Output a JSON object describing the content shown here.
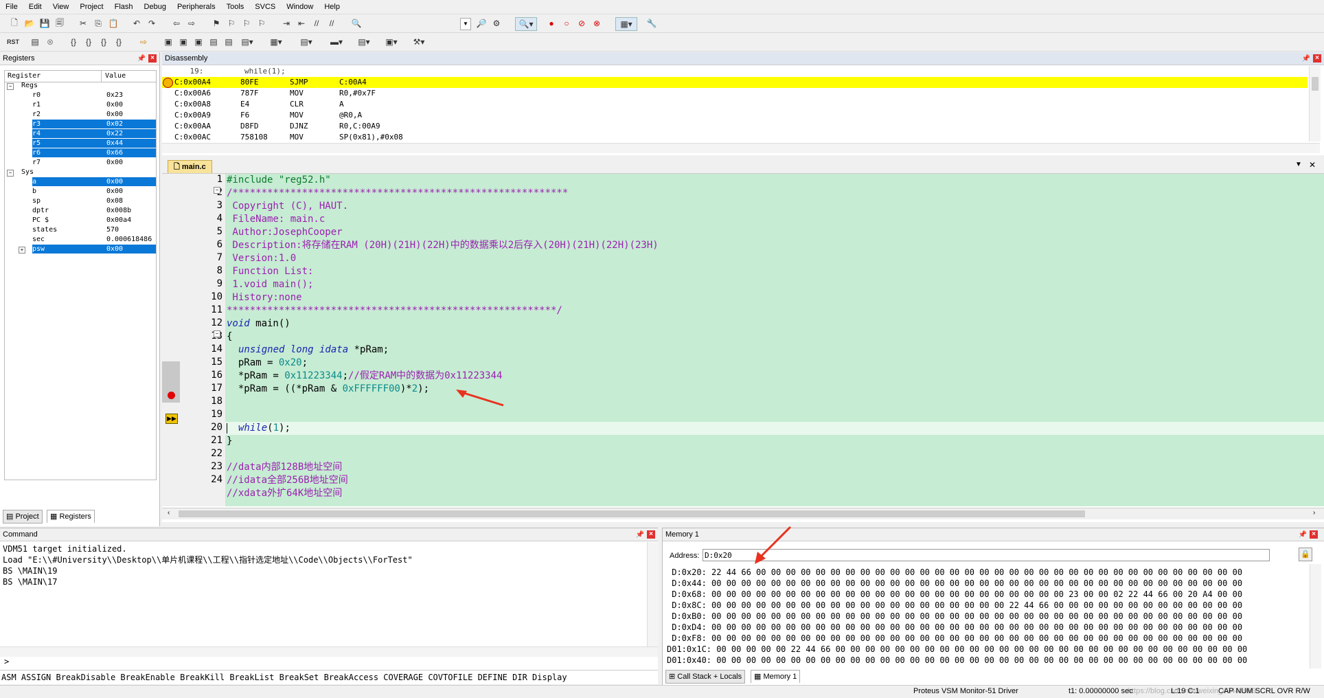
{
  "menu": [
    "File",
    "Edit",
    "View",
    "Project",
    "Flash",
    "Debug",
    "Peripherals",
    "Tools",
    "SVCS",
    "Window",
    "Help"
  ],
  "registers_pane": {
    "title": "Registers",
    "col_register": "Register",
    "col_value": "Value",
    "group_regs": "Regs",
    "group_sys": "Sys",
    "regs": [
      {
        "name": "r0",
        "value": "0x23",
        "selected": false
      },
      {
        "name": "r1",
        "value": "0x00",
        "selected": false
      },
      {
        "name": "r2",
        "value": "0x00",
        "selected": false
      },
      {
        "name": "r3",
        "value": "0x02",
        "selected": true
      },
      {
        "name": "r4",
        "value": "0x22",
        "selected": true
      },
      {
        "name": "r5",
        "value": "0x44",
        "selected": true
      },
      {
        "name": "r6",
        "value": "0x66",
        "selected": true
      },
      {
        "name": "r7",
        "value": "0x00",
        "selected": false
      }
    ],
    "sys": [
      {
        "name": "a",
        "value": "0x00",
        "selected": true
      },
      {
        "name": "b",
        "value": "0x00",
        "selected": false
      },
      {
        "name": "sp",
        "value": "0x08",
        "selected": false
      },
      {
        "name": "dptr",
        "value": "0x008b",
        "selected": false
      },
      {
        "name": "PC  $",
        "value": "0x00a4",
        "selected": false
      },
      {
        "name": "states",
        "value": "570",
        "selected": false
      },
      {
        "name": "sec",
        "value": "0.000618486",
        "selected": false
      },
      {
        "name": "psw",
        "value": "0x00",
        "selected": true
      }
    ],
    "tab_project": "Project",
    "tab_registers": "Registers"
  },
  "disassembly": {
    "title": "Disassembly",
    "source_line": "    19:         while(1);",
    "lines": [
      {
        "addr": "C:0x00A4",
        "bytes": "80FE",
        "mn": "SJMP",
        "op": "C:00A4",
        "current": true
      },
      {
        "addr": "C:0x00A6",
        "bytes": "787F",
        "mn": "MOV",
        "op": "R0,#0x7F",
        "current": false
      },
      {
        "addr": "C:0x00A8",
        "bytes": "E4",
        "mn": "CLR",
        "op": "A",
        "current": false
      },
      {
        "addr": "C:0x00A9",
        "bytes": "F6",
        "mn": "MOV",
        "op": "@R0,A",
        "current": false
      },
      {
        "addr": "C:0x00AA",
        "bytes": "D8FD",
        "mn": "DJNZ",
        "op": "R0,C:00A9",
        "current": false
      },
      {
        "addr": "C:0x00AC",
        "bytes": "758108",
        "mn": "MOV",
        "op": "SP(0x81),#0x08",
        "current": false
      }
    ]
  },
  "editor": {
    "tab": "main.c",
    "line_numbers": [
      "1",
      "2",
      "3",
      "4",
      "5",
      "6",
      "7",
      "8",
      "9",
      "10",
      "11",
      "12",
      "13",
      "14",
      "15",
      "16",
      "17",
      "18",
      "19",
      "20",
      "21",
      "22",
      "23",
      "24"
    ],
    "l1_pp": "#include ",
    "l1_str": "\"reg52.h\"",
    "l2": "/**********************************************************",
    "l3": " Copyright (C), HAUT.",
    "l4": " FileName: main.c",
    "l5": " Author:JosephCooper",
    "l6": " Description:将存储在RAM (20H)(21H)(22H)中的数据乘以2后存入(20H)(21H)(22H)(23H)",
    "l7": " Version:1.0",
    "l8": " Function List:",
    "l9": " 1.void main();",
    "l10": " History:none",
    "l11": "*********************************************************/",
    "l12_kw": "void",
    "l12_rest": " main()",
    "l13": "{",
    "l14_kw": "unsigned long idata",
    "l14_rest": " *pRam;",
    "l15_a": "  pRam = ",
    "l15_num": "0x20",
    "l15_b": ";",
    "l16_a": "  *pRam = ",
    "l16_num": "0x11223344",
    "l16_b": ";",
    "l16_cm": "//假定RAM中的数据为0x11223344",
    "l17_a": "  *pRam = ((*pRam & ",
    "l17_num": "0xFFFFFF00",
    "l17_b": ")*",
    "l17_num2": "2",
    "l17_c": ");",
    "l19_kw": "while",
    "l19_a": "(",
    "l19_num": "1",
    "l19_b": ");",
    "l20": "}",
    "l22": "//data内部128B地址空间",
    "l23": "//idata全部256B地址空间",
    "l24": "//xdata外扩64K地址空间"
  },
  "command": {
    "title": "Command",
    "lines": [
      "VDM51 target initialized.",
      "Load \"E:\\\\#University\\\\Desktop\\\\单片机课程\\\\工程\\\\指针选定地址\\\\Code\\\\Objects\\\\ForTest\"",
      "BS \\MAIN\\19",
      "BS \\MAIN\\17"
    ],
    "prompt": ">",
    "hint": "ASM ASSIGN BreakDisable BreakEnable BreakKill BreakList BreakSet BreakAccess COVERAGE COVTOFILE DEFINE DIR Display"
  },
  "memory": {
    "title": "Memory 1",
    "address_label": "Address:",
    "address_value": "D:0x20",
    "rows": [
      " D:0x20: 22 44 66 00 00 00 00 00 00 00 00 00 00 00 00 00 00 00 00 00 00 00 00 00 00 00 00 00 00 00 00 00 00 00 00 00",
      " D:0x44: 00 00 00 00 00 00 00 00 00 00 00 00 00 00 00 00 00 00 00 00 00 00 00 00 00 00 00 00 00 00 00 00 00 00 00 00",
      " D:0x68: 00 00 00 00 00 00 00 00 00 00 00 00 00 00 00 00 00 00 00 00 00 00 00 00 23 00 00 02 22 44 66 00 20 A4 00 00",
      " D:0x8C: 00 00 00 00 00 00 00 00 00 00 00 00 00 00 00 00 00 00 00 00 22 44 66 00 00 00 00 00 00 00 00 00 00 00 00 00",
      " D:0xB0: 00 00 00 00 00 00 00 00 00 00 00 00 00 00 00 00 00 00 00 00 00 00 00 00 00 00 00 00 00 00 00 00 00 00 00 00",
      " D:0xD4: 00 00 00 00 00 00 00 00 00 00 00 00 00 00 00 00 00 00 00 00 00 00 00 00 00 00 00 00 00 00 00 00 00 00 00 00",
      " D:0xF8: 00 00 00 00 00 00 00 00 00 00 00 00 00 00 00 00 00 00 00 00 00 00 00 00 00 00 00 00 00 00 00 00 00 00 00 00",
      "D01:0x1C: 00 00 00 00 00 22 44 66 00 00 00 00 00 00 00 00 00 00 00 00 00 00 00 00 00 00 00 00 00 00 00 00 00 00 00 00",
      "D01:0x40: 00 00 00 00 00 00 00 00 00 00 00 00 00 00 00 00 00 00 00 00 00 00 00 00 00 00 00 00 00 00 00 00 00 00 00 00"
    ],
    "tab_callstack": "Call Stack + Locals",
    "tab_memory": "Memory 1"
  },
  "status": {
    "driver": "Proteus VSM Monitor-51 Driver",
    "time": "t1: 0.00000000 sec",
    "pos": "L:19 C:1",
    "flags": "CAP  NUM  SCRL  OVR  R/W",
    "watermark": "https://blog.csdn.net/weixin_43444989"
  },
  "colors": {
    "editor_bg": "#c6ecd3",
    "current_line": "#ffff00",
    "selection": "#0a78d7",
    "arrow": "#e8321e"
  }
}
